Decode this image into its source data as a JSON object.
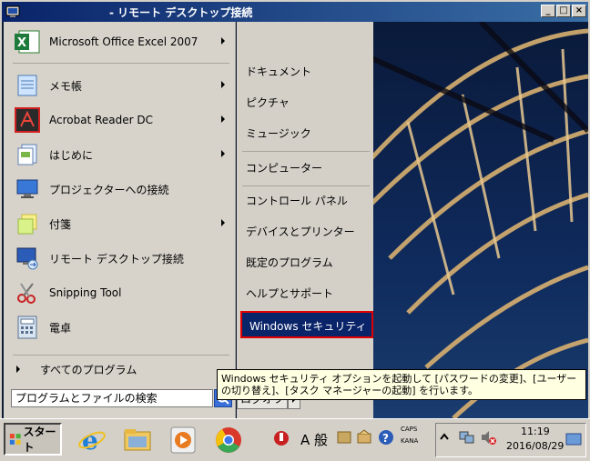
{
  "window": {
    "title": "- リモート デスクトップ接続"
  },
  "start_menu": {
    "programs": [
      {
        "label": "Microsoft Office Excel 2007",
        "icon": "excel-icon",
        "submenu": true
      },
      {
        "label": "メモ帳",
        "icon": "notepad-icon",
        "submenu": true
      },
      {
        "label": "Acrobat Reader DC",
        "icon": "acrobat-icon",
        "submenu": true
      },
      {
        "label": "はじめに",
        "icon": "getting-started-icon",
        "submenu": true
      },
      {
        "label": "プロジェクターへの接続",
        "icon": "projector-icon",
        "submenu": false
      },
      {
        "label": "付箋",
        "icon": "sticky-notes-icon",
        "submenu": true
      },
      {
        "label": "リモート デスクトップ接続",
        "icon": "remote-desktop-icon",
        "submenu": false
      },
      {
        "label": "Snipping Tool",
        "icon": "scissors-icon",
        "submenu": false
      },
      {
        "label": "電卓",
        "icon": "calculator-icon",
        "submenu": false
      }
    ],
    "all_programs": "すべてのプログラム",
    "search_placeholder": "プログラムとファイルの検索",
    "right_items": [
      "ドキュメント",
      "ピクチャ",
      "ミュージック",
      "コンピューター",
      "コントロール パネル",
      "デバイスとプリンター",
      "既定のプログラム",
      "ヘルプとサポート",
      "Windows セキュリティ"
    ],
    "logoff": "ログオフ",
    "tooltip": "Windows セキュリティ オプションを起動して [パスワードの変更]、[ユーザーの切り替え]、[タスク マネージャーの起動] を行います。"
  },
  "taskbar": {
    "start_label": "スタート",
    "ime_label": "A 般",
    "caps": "CAPS",
    "kana": "KANA",
    "time": "11:19",
    "date": "2016/08/29"
  },
  "colors": {
    "highlight": "#0a246a",
    "highlight_border": "#e00000",
    "tooltip_bg": "#ffffe1"
  }
}
